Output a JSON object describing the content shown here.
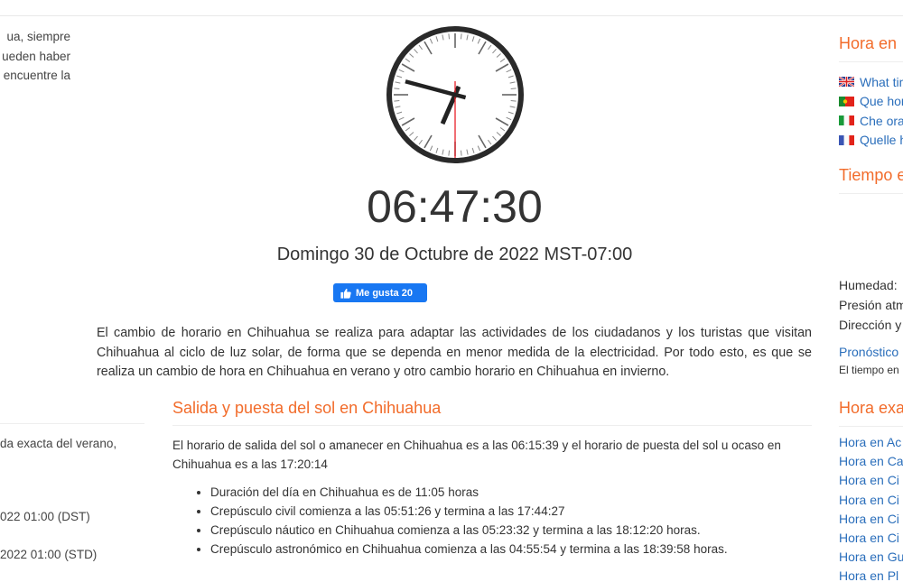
{
  "left": {
    "intro_lines": [
      "ua, siempre",
      "ueden haber",
      "encuentre la"
    ],
    "summer_line": "da exacta del verano,",
    "dst_line": "022 01:00 (DST)",
    "std_line": "2022 01:00 (STD)"
  },
  "clock": {
    "hours": 6,
    "minutes": 47,
    "seconds": 30,
    "second_hand_color": "#e8202a",
    "hand_color": "#222222"
  },
  "main": {
    "digital_time": "06:47:30",
    "date_line": "Domingo 30 de Octubre de 2022 MST-07:00",
    "like_button": {
      "label": "Me gusta 20",
      "icon": "thumbs-up-icon",
      "color": "#1877f2"
    },
    "intro_paragraph": "El cambio de horario en Chihuahua se realiza para adaptar las actividades de los ciudadanos y los turistas que visitan Chihuahua al ciclo de luz solar, de forma que se dependa en menor medida de la electricidad. Por todo esto, es que se realiza un cambio de hora en Chihuahua en verano y otro cambio horario en Chihuahua en invierno.",
    "sun_section": {
      "title": "Salida y puesta del sol en Chihuahua",
      "paragraph": "El horario de salida del sol o amanecer en Chihuahua es a las 06:15:39 y el horario de puesta del sol u ocaso en Chihuahua es a las 17:20:14",
      "items": [
        "Duración del día en Chihuahua es de 11:05 horas",
        "Crepúsculo civil comienza a las 05:51:26 y termina a las 17:44:27",
        "Crepúsculo náutico en Chihuahua comienza a las 05:23:32 y termina a las 18:12:20 horas.",
        "Crepúsculo astronómico en Chihuahua comienza a las 04:55:54 y termina a las 18:39:58 horas."
      ]
    }
  },
  "right": {
    "hora_heading": "Hora en",
    "languages": [
      {
        "label": "What time",
        "flag": "uk-flag-icon"
      },
      {
        "label": "Que hora",
        "flag": "portugal-flag-icon"
      },
      {
        "label": "Che ora",
        "flag": "italy-flag-icon"
      },
      {
        "label": "Quelle heure",
        "flag": "france-flag-icon"
      }
    ],
    "tiempo_heading": "Tiempo en",
    "weather_lines": [
      "Humedad:",
      "Presión atmosférica",
      "Dirección y"
    ],
    "forecast_link": "Pronóstico",
    "forecast_sub": "El tiempo en",
    "hora_exacta_heading": "Hora exacta",
    "cities": [
      "Hora en Ac",
      "Hora en Ca",
      "Hora en Ci",
      "Hora en Ci",
      "Hora en Ci",
      "Hora en Ci",
      "Hora en Gu",
      "Hora en Pl"
    ]
  },
  "colors": {
    "accent": "#f26c2b",
    "link": "#2a6ebb",
    "text": "#333333"
  }
}
